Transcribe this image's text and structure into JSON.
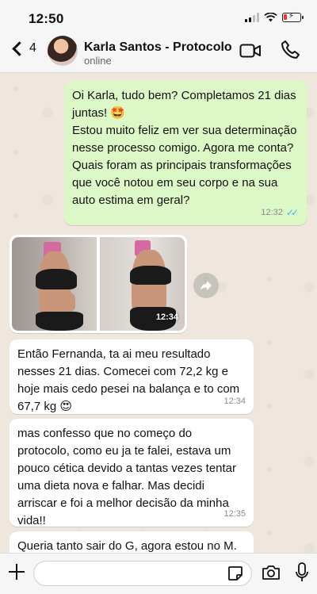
{
  "status_bar": {
    "time": "12:50",
    "battery_level": 0.2,
    "battery_color": "#e53935"
  },
  "header": {
    "back_count": "4",
    "contact_name": "Karla Santos - Protocolo",
    "contact_status": "online",
    "icons": [
      "back-chevron-icon",
      "video-call-icon",
      "phone-call-icon"
    ]
  },
  "messages": [
    {
      "direction": "outgoing",
      "text": "Oi Karla, tudo bem? Completamos 21 dias juntas! 🤩\nEstou muito feliz em ver sua determinação nesse processo comigo. Agora me conta? Quais foram as principais transformações que você notou em seu corpo e na sua auto estima em geral?",
      "time": "12:32",
      "read": true
    },
    {
      "direction": "incoming",
      "type": "photo",
      "time": "12:34"
    },
    {
      "direction": "incoming",
      "text": "Então Fernanda, ta ai meu resultado nesses 21 dias. Comecei com 72,2 kg e hoje mais cedo pesei na balança e to com 67,7 kg 😍",
      "time": "12:34"
    },
    {
      "direction": "incoming",
      "text": "mas confesso que no começo do protocolo, como eu ja te falei, estava um pouco cética devido a tantas vezes tentar uma dieta nova e falhar. Mas decidi arriscar e foi a melhor decisão da minha vida!!",
      "time": "12:35"
    },
    {
      "direction": "incoming",
      "text": "Queria tanto sair do G, agora estou no M."
    }
  ],
  "input_bar": {
    "placeholder": "",
    "icons": [
      "plus-icon",
      "sticker-icon",
      "camera-icon",
      "microphone-icon"
    ]
  },
  "colors": {
    "outgoing_bubble": "#dcf8c6",
    "incoming_bubble": "#ffffff",
    "read_ticks": "#34b7f1",
    "chat_background": "#efe7dd"
  }
}
